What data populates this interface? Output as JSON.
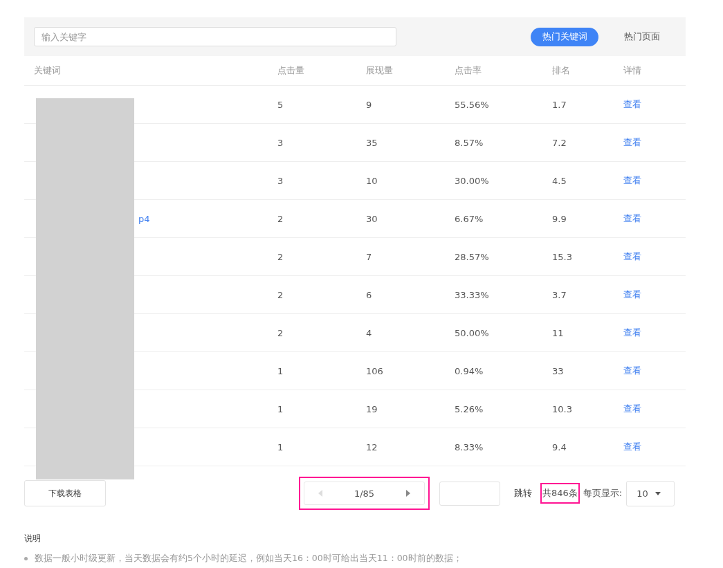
{
  "search": {
    "placeholder": "输入关键字"
  },
  "tabs": [
    {
      "label": "热门关键词",
      "selected": true
    },
    {
      "label": "热门页面",
      "selected": false
    }
  ],
  "table": {
    "columns": [
      "关键词",
      "点击量",
      "展现量",
      "点击率",
      "排名",
      "详情"
    ],
    "redacted": true,
    "rows": [
      {
        "clicks": "5",
        "impressions": "9",
        "ctr": "55.56%",
        "rank": "1.7",
        "detail": "查看"
      },
      {
        "clicks": "3",
        "impressions": "35",
        "ctr": "8.57%",
        "rank": "7.2",
        "detail": "查看"
      },
      {
        "clicks": "3",
        "impressions": "10",
        "ctr": "30.00%",
        "rank": "4.5",
        "detail": "查看"
      },
      {
        "keyword": "p4",
        "clicks": "2",
        "impressions": "30",
        "ctr": "6.67%",
        "rank": "9.9",
        "detail": "查看"
      },
      {
        "clicks": "2",
        "impressions": "7",
        "ctr": "28.57%",
        "rank": "15.3",
        "detail": "查看"
      },
      {
        "clicks": "2",
        "impressions": "6",
        "ctr": "33.33%",
        "rank": "3.7",
        "detail": "查看"
      },
      {
        "clicks": "2",
        "impressions": "4",
        "ctr": "50.00%",
        "rank": "11",
        "detail": "查看"
      },
      {
        "clicks": "1",
        "impressions": "106",
        "ctr": "0.94%",
        "rank": "33",
        "detail": "查看"
      },
      {
        "clicks": "1",
        "impressions": "19",
        "ctr": "5.26%",
        "rank": "10.3",
        "detail": "查看"
      },
      {
        "clicks": "1",
        "impressions": "12",
        "ctr": "8.33%",
        "rank": "9.4",
        "detail": "查看"
      }
    ]
  },
  "footer": {
    "download": "下载表格",
    "pager": {
      "text": "1/85",
      "highlighted": true,
      "prev_disabled": true,
      "next_disabled": false
    },
    "jump": "跳转",
    "total": {
      "text": "共846条",
      "highlighted": true
    },
    "per_page_label": "每页显示:",
    "per_page": "10"
  },
  "notes": {
    "title": "说明",
    "items": [
      "数据一般小时级更新，当天数据会有约5个小时的延迟，例如当天16：00时可给出当天11：00时前的数据；"
    ]
  }
}
